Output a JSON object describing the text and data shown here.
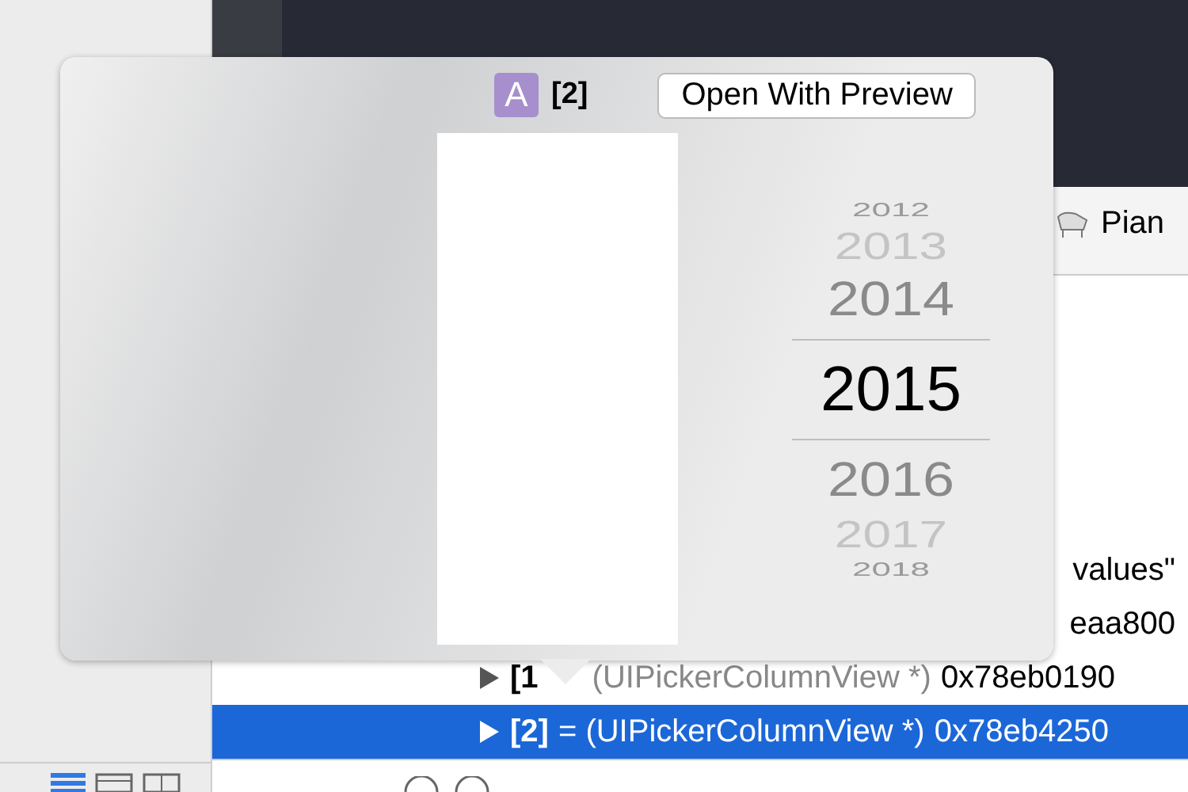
{
  "tab": {
    "label": "Pian"
  },
  "variables": [
    {
      "kind": "text",
      "text": "values\"",
      "selected": false
    },
    {
      "kind": "text",
      "text": "eaa800",
      "selected": false
    },
    {
      "kind": "variable",
      "index": "[1",
      "type": "(UIPickerColumnView *)",
      "address": "0x78eb0190",
      "selected": false
    },
    {
      "kind": "variable",
      "index": "[2]",
      "type": "= (UIPickerColumnView *)",
      "address": "0x78eb4250",
      "selected": true
    }
  ],
  "popover": {
    "icon_letter": "A",
    "title": "[2]",
    "button": "Open With Preview",
    "picker": [
      {
        "label": "2012",
        "selected": false
      },
      {
        "label": "2013",
        "selected": false
      },
      {
        "label": "2014",
        "selected": false
      },
      {
        "label": "2015",
        "selected": true
      },
      {
        "label": "2016",
        "selected": false
      },
      {
        "label": "2017",
        "selected": false
      },
      {
        "label": "2018",
        "selected": false
      }
    ]
  }
}
